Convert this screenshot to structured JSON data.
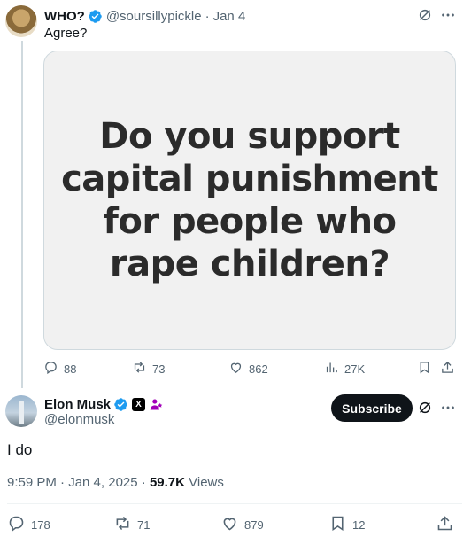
{
  "quoted_tweet": {
    "display_name": "WHO?",
    "handle": "@soursillypickle",
    "separator": "·",
    "date": "Jan 4",
    "text": "Agree?",
    "image_text": [
      "Do you support",
      "capital punishment",
      "for people who",
      "rape children?"
    ],
    "stats": {
      "replies": "88",
      "reposts": "73",
      "likes": "862",
      "views": "27K"
    }
  },
  "main_tweet": {
    "display_name": "Elon Musk",
    "handle": "@elonmusk",
    "subscribe_label": "Subscribe",
    "text": "I do",
    "timestamp": "9:59 PM · Jan 4, 2025 ·",
    "views_count": "59.7K",
    "views_label": "Views",
    "stats": {
      "replies": "178",
      "reposts": "71",
      "likes": "879",
      "bookmarks": "12"
    }
  },
  "icons": {
    "verified": "verified-badge-icon",
    "x_badge": "X",
    "grok": "grok-icon",
    "more": "more-icon",
    "reply": "reply-icon",
    "repost": "repost-icon",
    "like": "heart-icon",
    "views": "analytics-icon",
    "bookmark": "bookmark-icon",
    "share": "share-icon"
  },
  "colors": {
    "verified": "#1d9bf0",
    "gov_badge": "#a100b8",
    "muted": "#536471",
    "text": "#0f1419"
  }
}
